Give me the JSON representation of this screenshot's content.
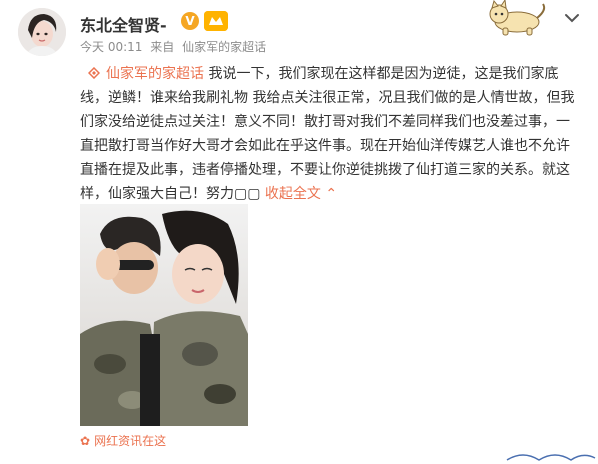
{
  "post": {
    "author": {
      "name": "东北全智贤-",
      "verified_icon": "verified-v-icon",
      "level_icon": "vip-level-icon"
    },
    "meta": {
      "time": "今天 00:11",
      "source_prefix": "来自",
      "source": "仙家军的家超话"
    },
    "content": {
      "topic": "仙家军的家超话",
      "text": "我说一下，我们家现在这样都是因为逆徒，这是我们家底线，逆鳞！谁来给我刷礼物 我给点关注很正常，况且我们做的是人情世故，但我们家没给逆徒点过关注！意义不同！散打哥对我们不差同样我们也没差过事，一直把散打哥当作好大哥才会如此在乎这件事。现在开始仙洋传媒艺人谁也不允许直播在提及此事，违者停播处理，不要让你逆徒挑拨了仙打道三家的关系。就这样，仙家强大自己！努力▢▢ ",
      "collapse_label": "收起全文 ⌃"
    },
    "watermark": {
      "icon": "flower-icon",
      "text": "网红资讯在这"
    }
  },
  "colors": {
    "link": "#eb7350",
    "meta": "#8c8c8c",
    "text": "#333333",
    "badge": "#f5a623"
  },
  "icons": {
    "dropdown": "chevron-down-icon",
    "topic": "supertopic-diamond-icon",
    "decor": "cartoon-cat-icon"
  }
}
